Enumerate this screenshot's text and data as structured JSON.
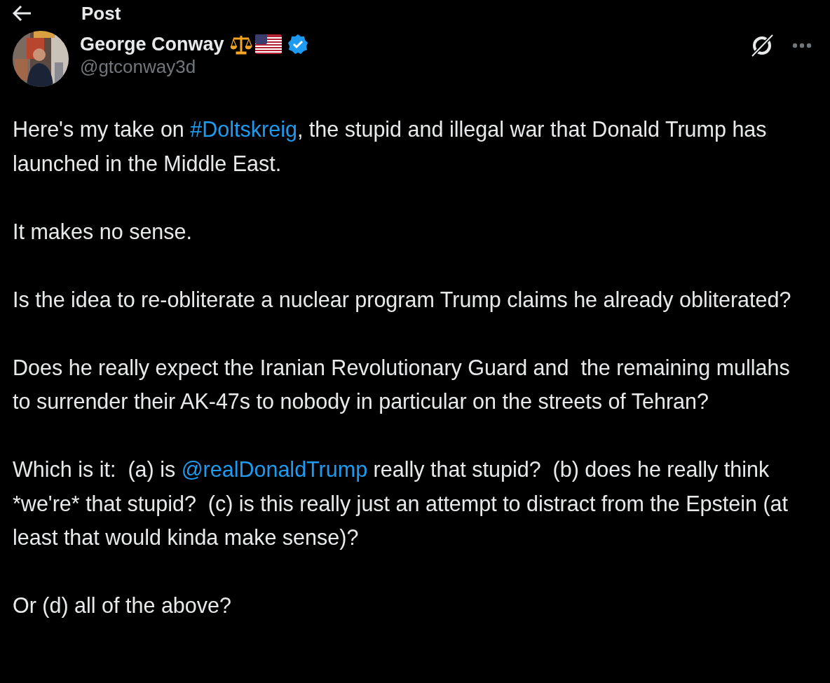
{
  "header": {
    "title": "Post"
  },
  "post": {
    "author": {
      "name": "George Conway",
      "handle": "@gtconway3d",
      "verified": true
    },
    "paragraphs": [
      [
        {
          "kind": "text",
          "text": "Here's my take on "
        },
        {
          "kind": "hashtag",
          "text": "#Doltskreig"
        },
        {
          "kind": "text",
          "text": ", the stupid and illegal war that Donald Trump has launched in the Middle East."
        }
      ],
      [
        {
          "kind": "text",
          "text": "It makes no sense."
        }
      ],
      [
        {
          "kind": "text",
          "text": "Is the idea to re-obliterate a nuclear program Trump claims he already obliterated?"
        }
      ],
      [
        {
          "kind": "text",
          "text": "Does he really expect the Iranian Revolutionary Guard and  the remaining mullahs to surrender their AK-47s to nobody in particular on the streets of Tehran?"
        }
      ],
      [
        {
          "kind": "text",
          "text": "Which is it:  (a) is "
        },
        {
          "kind": "mention",
          "text": "@realDonaldTrump"
        },
        {
          "kind": "text",
          "text": " really that stupid?  (b) does he really think *we're* that stupid?  (c) is this really just an attempt to distract from the Epstein (at least that would kinda make sense)?"
        }
      ],
      [
        {
          "kind": "text",
          "text": "Or (d) all of the above?"
        }
      ]
    ]
  }
}
